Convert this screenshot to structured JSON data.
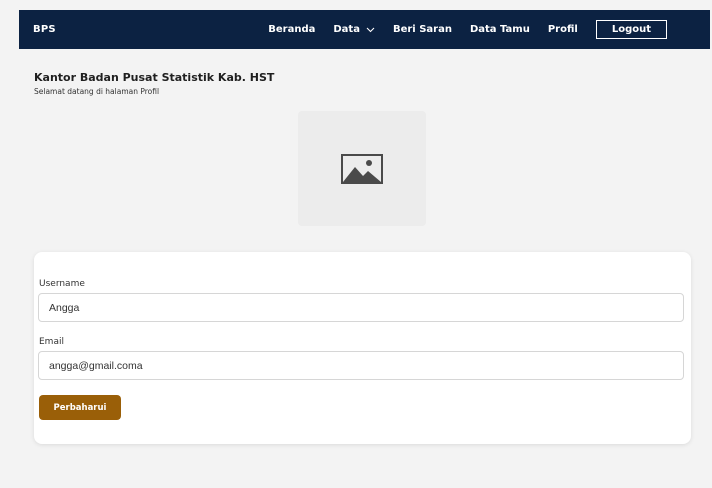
{
  "navbar": {
    "brand": "BPS",
    "links": [
      {
        "label": "Beranda"
      },
      {
        "label": "Data",
        "has_dropdown": true
      },
      {
        "label": "Beri Saran"
      },
      {
        "label": "Data Tamu"
      },
      {
        "label": "Profil"
      }
    ],
    "logout_label": "Logout"
  },
  "header": {
    "title": "Kantor Badan Pusat Statistik Kab. HST",
    "subtitle": "Selamat datang di halaman Profil"
  },
  "profile_photo": {
    "icon": "image-placeholder-icon"
  },
  "form": {
    "username_label": "Username",
    "username_value": "Angga",
    "email_label": "Email",
    "email_value": "angga@gmail.coma",
    "submit_label": "Perbaharui"
  },
  "colors": {
    "navbar_bg": "#0c2242",
    "button_bg": "#9a5f08",
    "page_bg": "#f3f3f3"
  }
}
